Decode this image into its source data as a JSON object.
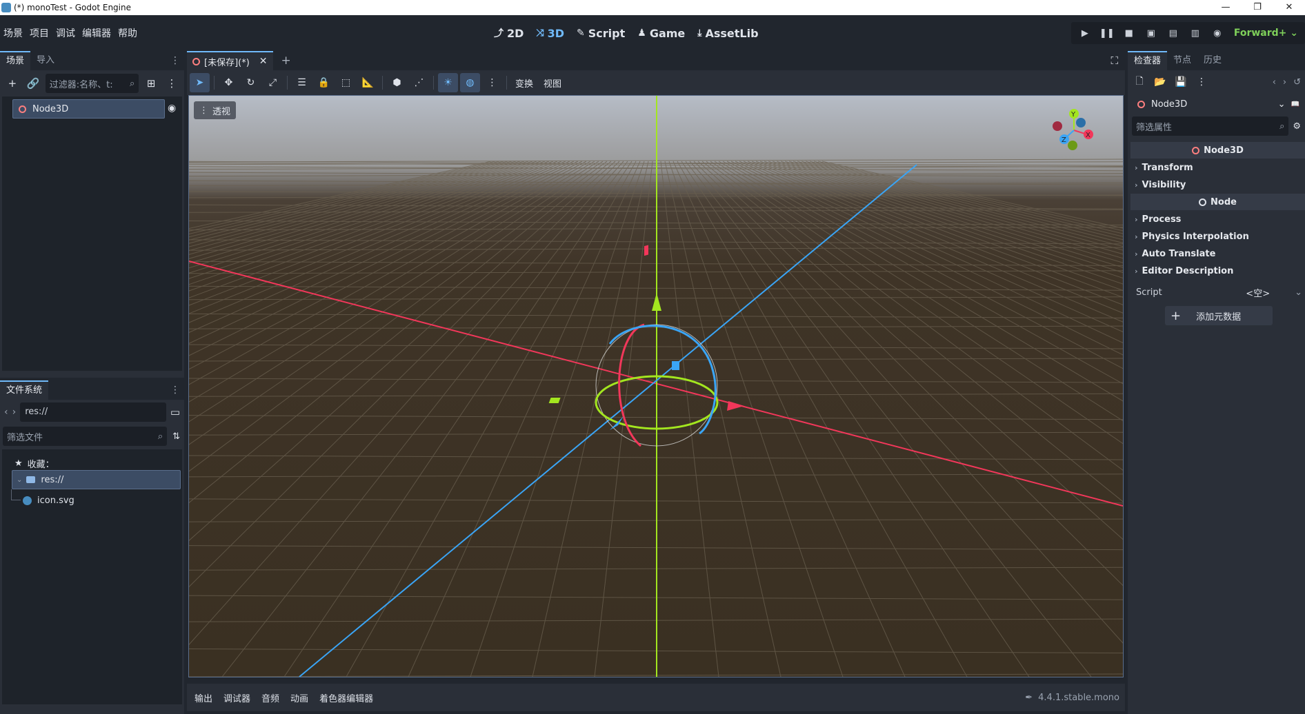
{
  "window": {
    "title": "(*) monoTest - Godot Engine",
    "controls": [
      "—",
      "❐",
      "✕"
    ]
  },
  "menu": [
    "场景",
    "项目",
    "调试",
    "编辑器",
    "帮助"
  ],
  "main_modes": [
    {
      "label": "2D",
      "icon": "2d-icon",
      "active": false
    },
    {
      "label": "3D",
      "icon": "3d-icon",
      "active": true
    },
    {
      "label": "Script",
      "icon": "script-icon",
      "active": false
    },
    {
      "label": "Game",
      "icon": "game-icon",
      "active": false
    },
    {
      "label": "AssetLib",
      "icon": "assetlib-icon",
      "active": false
    }
  ],
  "renderer": "Forward+",
  "scene_dock": {
    "tabs": [
      "场景",
      "导入"
    ],
    "filter_placeholder": "过滤器:名称、t:",
    "root_node": "Node3D"
  },
  "filesystem_dock": {
    "tab": "文件系统",
    "path": "res://",
    "filter_placeholder": "筛选文件",
    "favorites": "收藏：",
    "root": "res://",
    "files": [
      "icon.svg"
    ]
  },
  "document_tab": {
    "label": "[未保存](*)"
  },
  "viewport_toolbar": {
    "transform_menu": "变换",
    "view_menu": "视图"
  },
  "viewport": {
    "perspective_label": "透视",
    "gizmo_axes": [
      "X",
      "Y",
      "Z"
    ],
    "colors": {
      "x_axis": "#f2375a",
      "y_axis": "#a3e61f",
      "z_axis": "#3aa5f6"
    }
  },
  "bottom_panel": {
    "tabs": [
      "输出",
      "调试器",
      "音频",
      "动画",
      "着色器编辑器"
    ],
    "version": "4.4.1.stable.mono"
  },
  "inspector": {
    "tabs": [
      "检查器",
      "节点",
      "历史"
    ],
    "object_name": "Node3D",
    "filter_placeholder": "筛选属性",
    "categories": [
      {
        "title": "Node3D",
        "sections": [
          "Transform",
          "Visibility"
        ]
      },
      {
        "title": "Node",
        "sections": [
          "Process",
          "Physics Interpolation",
          "Auto Translate",
          "Editor Description"
        ]
      }
    ],
    "script_label": "Script",
    "script_value": "<空>",
    "add_metadata": "添加元数据"
  }
}
